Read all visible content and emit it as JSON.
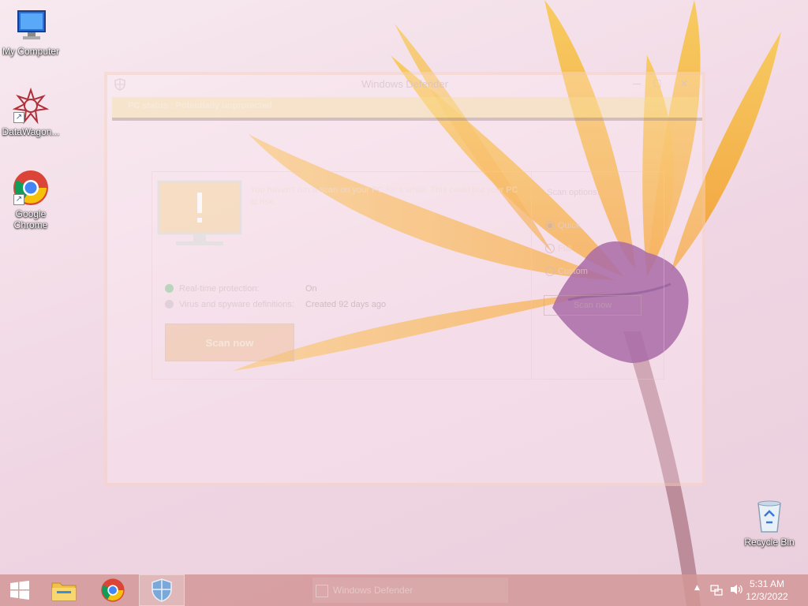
{
  "desktop": {
    "icons": [
      {
        "label": "My Computer",
        "icon": "computer-icon"
      },
      {
        "label": "DataWagon...",
        "icon": "datawagon-icon"
      },
      {
        "label": "Google Chrome",
        "icon": "chrome-icon"
      },
      {
        "label": "Recycle Bin",
        "icon": "recycle-bin-icon"
      }
    ]
  },
  "defender": {
    "title": "Windows Defender",
    "status": "PC status : Potentially unprotected",
    "message": "You haven't run a scan on your PC for a while. This could put your PC at risk.",
    "realtime_label": "Real-time protection:",
    "realtime_value": "On",
    "definitions_label": "Virus and spyware definitions:",
    "definitions_value": "Created 92 days ago",
    "scan_now_label": "Scan now",
    "scan_options_title": "Scan options:",
    "options": [
      "Quick",
      "Full",
      "Custom"
    ],
    "selected_option": "Quick",
    "options_scan_button": "Scan now"
  },
  "taskbar": {
    "pinned": [
      "start-icon",
      "file-explorer-icon",
      "chrome-icon",
      "windows-defender-icon"
    ],
    "ghost_window_label": "Windows Defender",
    "time": "5:31 AM",
    "date": "12/3/2022"
  },
  "colors": {
    "taskbar": "#d29696",
    "status_bar": "#f7e1a0",
    "petal": "#f5b030"
  }
}
